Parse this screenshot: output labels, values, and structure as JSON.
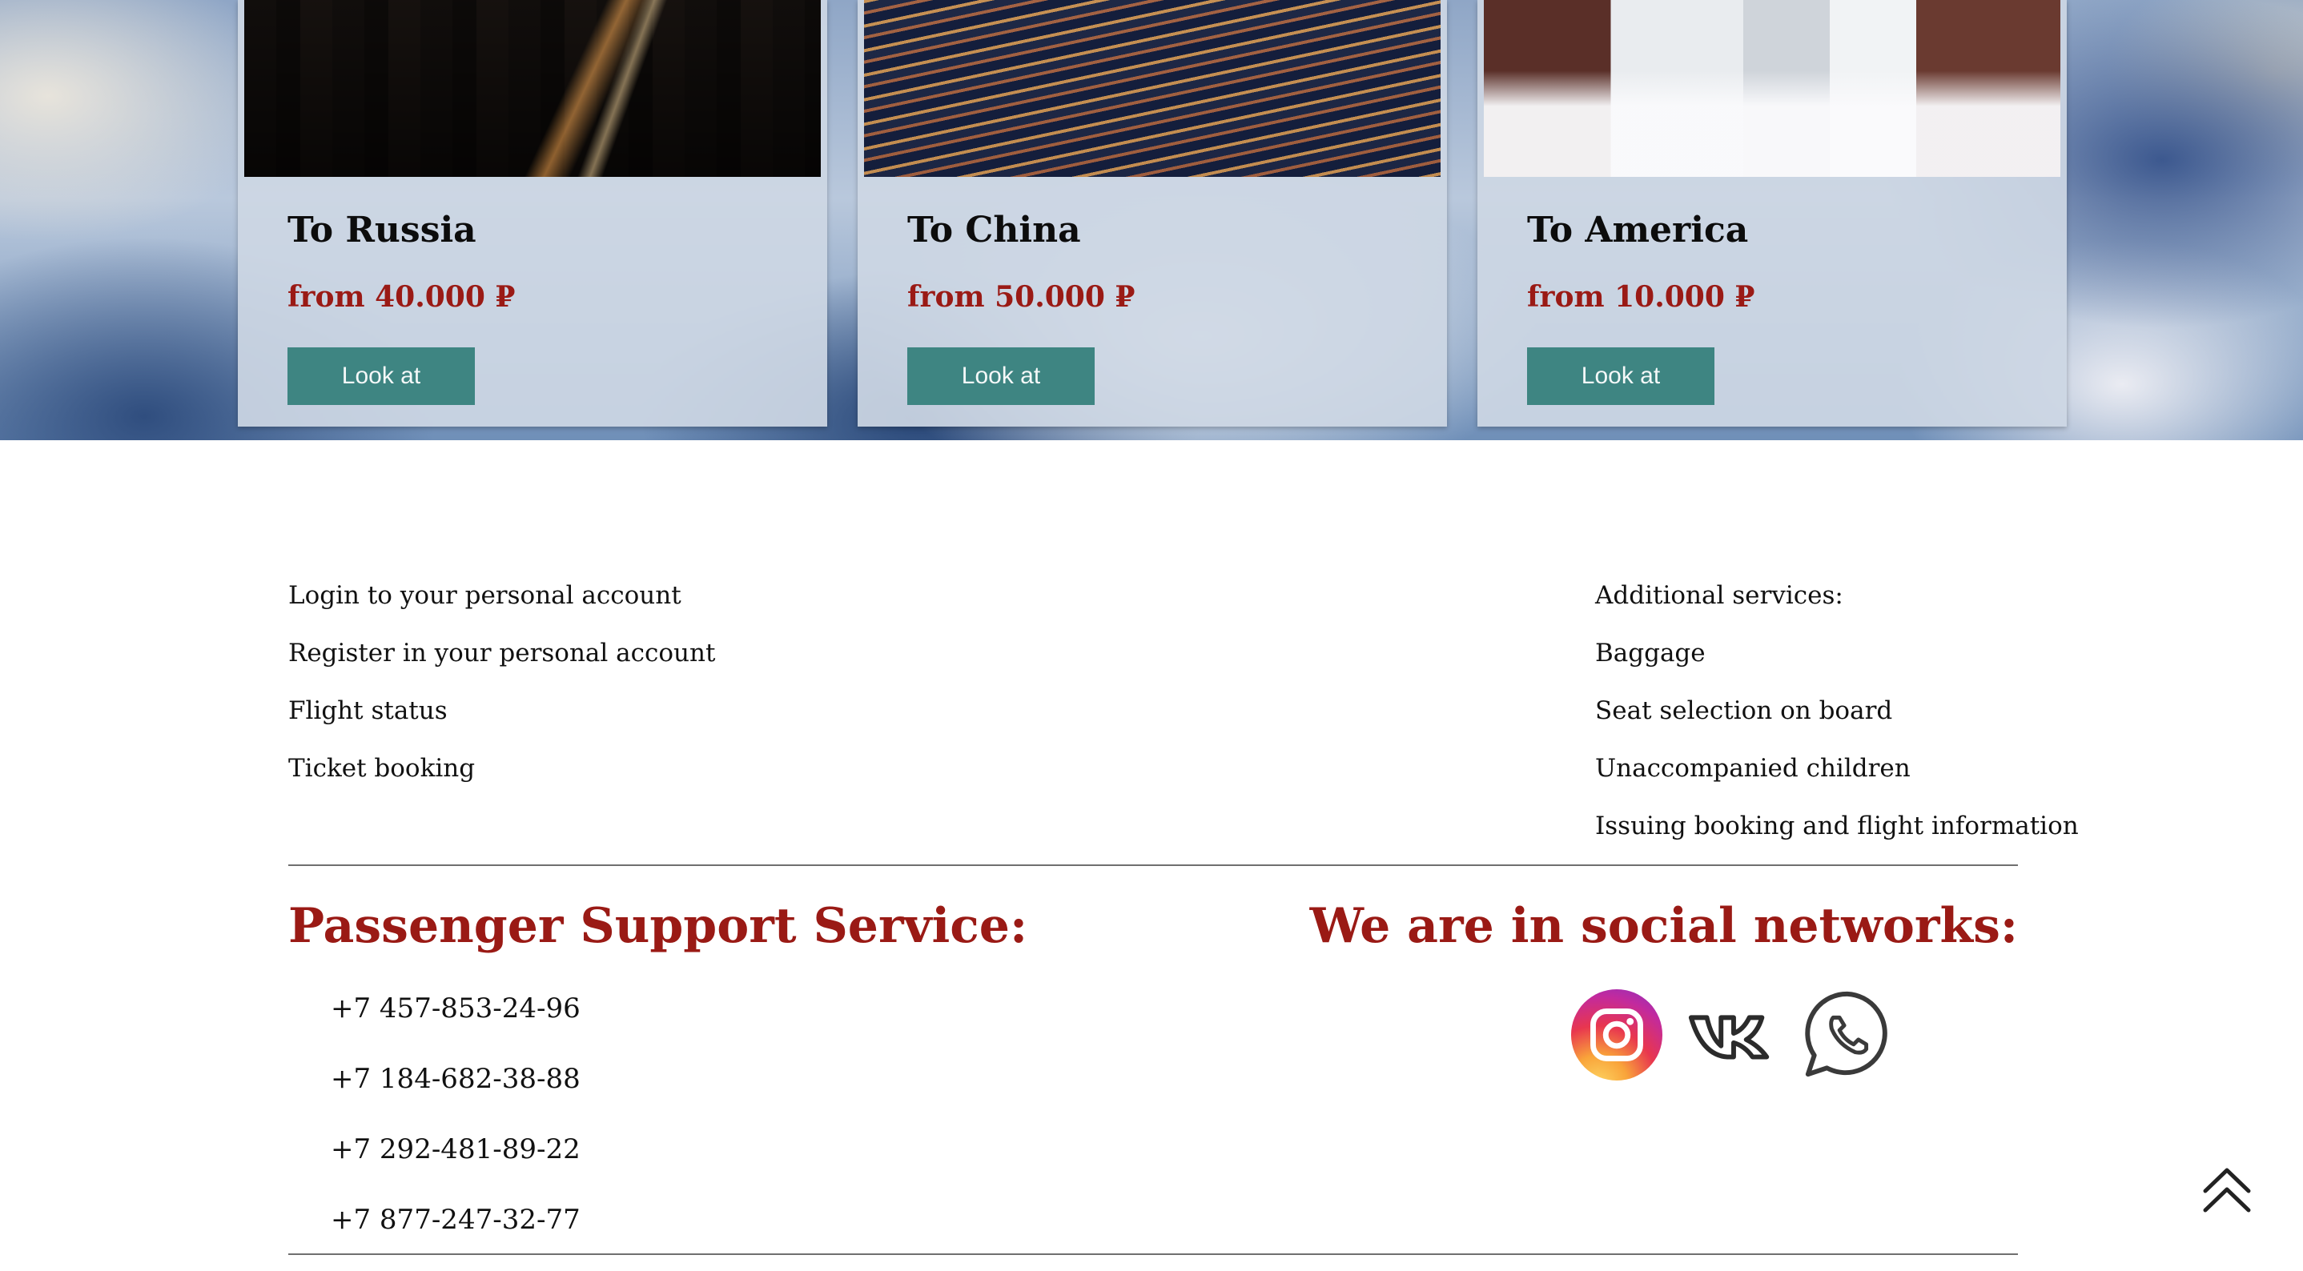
{
  "destinations": [
    {
      "title": "To Russia",
      "price": "from 40.000 ₽",
      "button": "Look at",
      "photo_icon": "city-street-night-photo"
    },
    {
      "title": "To China",
      "price": "from 50.000 ₽",
      "button": "Look at",
      "photo_icon": "highway-interchange-photo"
    },
    {
      "title": "To America",
      "price": "from 10.000 ₽",
      "button": "Look at",
      "photo_icon": "snowy-street-photo"
    }
  ],
  "footer": {
    "left_links": [
      "Login to your personal account",
      "Register in your personal account",
      "Flight status",
      "Ticket booking"
    ],
    "additional": {
      "heading": "Additional services:",
      "items": [
        "Baggage",
        "Seat selection on board",
        "Unaccompanied children",
        "Issuing booking and flight information"
      ]
    },
    "support": {
      "title": "Passenger Support Service:",
      "phones": [
        "+7 457-853-24-96",
        "+7 184-682-38-88",
        "+7 292-481-89-22",
        "+7 877-247-32-77"
      ]
    },
    "social": {
      "title": "We are in social networks:",
      "networks": [
        "instagram-icon",
        "vk-icon",
        "whatsapp-icon"
      ]
    }
  },
  "colors": {
    "accent_red": "#9a1a15",
    "button_teal": "#3e8582",
    "card_bg": "#cdd7e4"
  },
  "scroll_top_icon": "double-chevron-up-icon"
}
